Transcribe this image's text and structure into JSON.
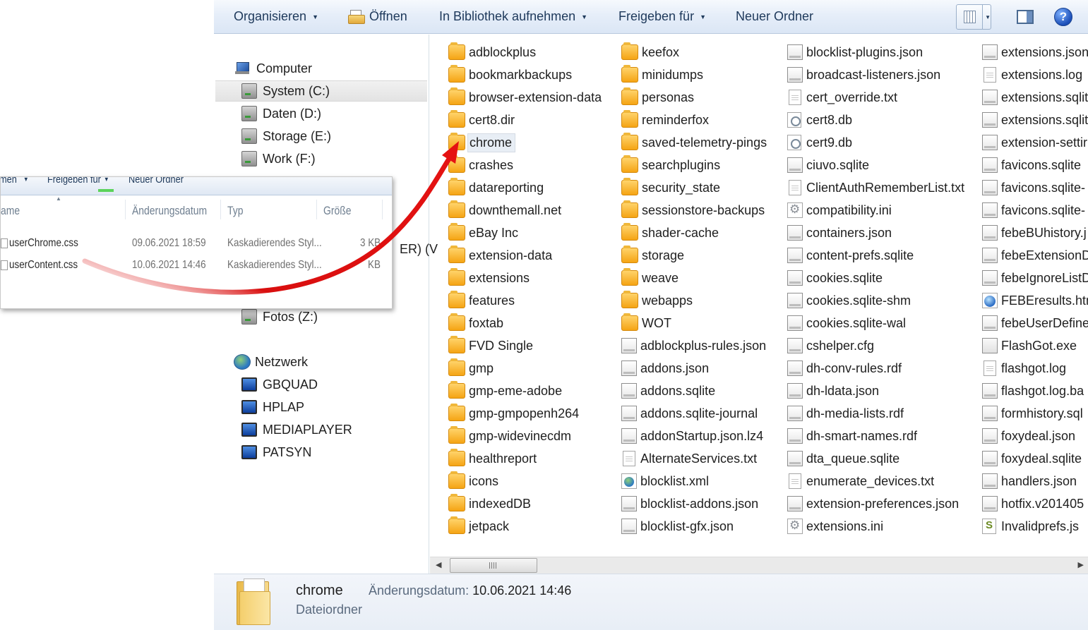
{
  "toolbar": {
    "organize": "Organisieren",
    "open": "Öffnen",
    "library": "In Bibliothek aufnehmen",
    "share": "Freigeben für",
    "new_folder": "Neuer Ordner"
  },
  "nav": {
    "computer": "Computer",
    "drives": [
      "System (C:)",
      "Daten (D:)",
      "Storage (E:)",
      "Work (F:)"
    ],
    "fotos": "Fotos (Z:)",
    "network": "Netzwerk",
    "hosts": [
      "GBQUAD",
      "HPLAP",
      "MEDIAPLAYER",
      "PATSYN"
    ],
    "partial": "ER) (V"
  },
  "files": {
    "col1": [
      {
        "name": "adblockplus",
        "icon": "folder"
      },
      {
        "name": "bookmarkbackups",
        "icon": "folder"
      },
      {
        "name": "browser-extension-data",
        "icon": "folder"
      },
      {
        "name": "cert8.dir",
        "icon": "folder"
      },
      {
        "name": "chrome",
        "icon": "folder",
        "selected": true
      },
      {
        "name": "crashes",
        "icon": "folder"
      },
      {
        "name": "datareporting",
        "icon": "folder"
      },
      {
        "name": "downthemall.net",
        "icon": "folder"
      },
      {
        "name": "eBay Inc",
        "icon": "folder"
      },
      {
        "name": "extension-data",
        "icon": "folder"
      },
      {
        "name": "extensions",
        "icon": "folder"
      },
      {
        "name": "features",
        "icon": "folder"
      },
      {
        "name": "foxtab",
        "icon": "folder"
      },
      {
        "name": "FVD Single",
        "icon": "folder"
      },
      {
        "name": "gmp",
        "icon": "folder"
      },
      {
        "name": "gmp-eme-adobe",
        "icon": "folder"
      },
      {
        "name": "gmp-gmpopenh264",
        "icon": "folder"
      },
      {
        "name": "gmp-widevinecdm",
        "icon": "folder"
      },
      {
        "name": "healthreport",
        "icon": "folder"
      },
      {
        "name": "icons",
        "icon": "folder"
      },
      {
        "name": "indexedDB",
        "icon": "folder"
      },
      {
        "name": "jetpack",
        "icon": "folder"
      }
    ],
    "col2": [
      {
        "name": "keefox",
        "icon": "folder"
      },
      {
        "name": "minidumps",
        "icon": "folder"
      },
      {
        "name": "personas",
        "icon": "folder"
      },
      {
        "name": "reminderfox",
        "icon": "folder"
      },
      {
        "name": "saved-telemetry-pings",
        "icon": "folder"
      },
      {
        "name": "searchplugins",
        "icon": "folder"
      },
      {
        "name": "security_state",
        "icon": "folder"
      },
      {
        "name": "sessionstore-backups",
        "icon": "folder"
      },
      {
        "name": "shader-cache",
        "icon": "folder"
      },
      {
        "name": "storage",
        "icon": "folder"
      },
      {
        "name": "weave",
        "icon": "folder"
      },
      {
        "name": "webapps",
        "icon": "folder"
      },
      {
        "name": "WOT",
        "icon": "folder"
      },
      {
        "name": "adblockplus-rules.json",
        "icon": "file-gen"
      },
      {
        "name": "addons.json",
        "icon": "file-gen"
      },
      {
        "name": "addons.sqlite",
        "icon": "file-gen"
      },
      {
        "name": "addons.sqlite-journal",
        "icon": "file-gen"
      },
      {
        "name": "addonStartup.json.lz4",
        "icon": "file-gen"
      },
      {
        "name": "AlternateServices.txt",
        "icon": "file-txt"
      },
      {
        "name": "blocklist.xml",
        "icon": "file-xml"
      },
      {
        "name": "blocklist-addons.json",
        "icon": "file-gen"
      },
      {
        "name": "blocklist-gfx.json",
        "icon": "file-gen"
      }
    ],
    "col3": [
      {
        "name": "blocklist-plugins.json",
        "icon": "file-gen"
      },
      {
        "name": "broadcast-listeners.json",
        "icon": "file-gen"
      },
      {
        "name": "cert_override.txt",
        "icon": "file-txt"
      },
      {
        "name": "cert8.db",
        "icon": "file-db"
      },
      {
        "name": "cert9.db",
        "icon": "file-db"
      },
      {
        "name": "ciuvo.sqlite",
        "icon": "file-gen"
      },
      {
        "name": "ClientAuthRememberList.txt",
        "icon": "file-txt"
      },
      {
        "name": "compatibility.ini",
        "icon": "file-ini"
      },
      {
        "name": "containers.json",
        "icon": "file-gen"
      },
      {
        "name": "content-prefs.sqlite",
        "icon": "file-gen"
      },
      {
        "name": "cookies.sqlite",
        "icon": "file-gen"
      },
      {
        "name": "cookies.sqlite-shm",
        "icon": "file-gen"
      },
      {
        "name": "cookies.sqlite-wal",
        "icon": "file-gen"
      },
      {
        "name": "cshelper.cfg",
        "icon": "file-gen"
      },
      {
        "name": "dh-conv-rules.rdf",
        "icon": "file-gen"
      },
      {
        "name": "dh-ldata.json",
        "icon": "file-gen"
      },
      {
        "name": "dh-media-lists.rdf",
        "icon": "file-gen"
      },
      {
        "name": "dh-smart-names.rdf",
        "icon": "file-gen"
      },
      {
        "name": "dta_queue.sqlite",
        "icon": "file-gen"
      },
      {
        "name": "enumerate_devices.txt",
        "icon": "file-txt"
      },
      {
        "name": "extension-preferences.json",
        "icon": "file-gen"
      },
      {
        "name": "extensions.ini",
        "icon": "file-ini"
      }
    ],
    "col4": [
      {
        "name": "extensions.json",
        "icon": "file-gen"
      },
      {
        "name": "extensions.log",
        "icon": "file-txt"
      },
      {
        "name": "extensions.sqlit",
        "icon": "file-gen"
      },
      {
        "name": "extensions.sqlit",
        "icon": "file-gen"
      },
      {
        "name": "extension-settir",
        "icon": "file-gen"
      },
      {
        "name": "favicons.sqlite",
        "icon": "file-gen"
      },
      {
        "name": "favicons.sqlite-",
        "icon": "file-gen"
      },
      {
        "name": "favicons.sqlite-",
        "icon": "file-gen"
      },
      {
        "name": "febeBUhistory.j",
        "icon": "file-gen"
      },
      {
        "name": "febeExtensionD",
        "icon": "file-gen"
      },
      {
        "name": "febeIgnoreListD",
        "icon": "file-gen"
      },
      {
        "name": "FEBEresults.htm",
        "icon": "file-html"
      },
      {
        "name": "febeUserDefine",
        "icon": "file-gen"
      },
      {
        "name": "FlashGot.exe",
        "icon": "file-exe"
      },
      {
        "name": "flashgot.log",
        "icon": "file-txt"
      },
      {
        "name": "flashgot.log.ba",
        "icon": "file-gen"
      },
      {
        "name": "formhistory.sql",
        "icon": "file-gen"
      },
      {
        "name": "foxydeal.json",
        "icon": "file-gen"
      },
      {
        "name": "foxydeal.sqlite",
        "icon": "file-gen"
      },
      {
        "name": "handlers.json",
        "icon": "file-gen"
      },
      {
        "name": "hotfix.v201405",
        "icon": "file-gen"
      },
      {
        "name": "Invalidprefs.js",
        "icon": "file-js"
      }
    ]
  },
  "details": {
    "name": "chrome",
    "type": "Dateiordner",
    "date_label": "Änderungsdatum:",
    "date_value": "10.06.2021 14:46"
  },
  "inset": {
    "toolbar_partial": [
      "men",
      "Freigeben für",
      "Neuer Ordner"
    ],
    "columns": [
      "ame",
      "Änderungsdatum",
      "Typ",
      "Größe"
    ],
    "rows": [
      {
        "name": "userChrome.css",
        "date": "09.06.2021 18:59",
        "type": "Kaskadierendes Styl...",
        "size": "3 KB"
      },
      {
        "name": "userContent.css",
        "date": "10.06.2021 14:46",
        "type": "Kaskadierendes Styl...",
        "size": "KB"
      }
    ]
  },
  "colors": {
    "toolbar_text": "#1e395b",
    "arrow": "#e01010",
    "folder": "#f5a414"
  }
}
